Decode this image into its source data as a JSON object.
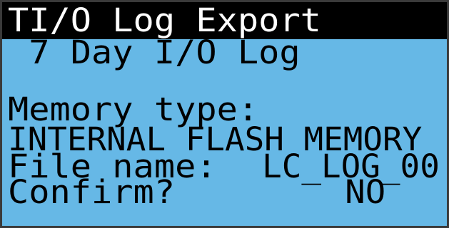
{
  "title": "TI/O Log Export",
  "subtitle": " 7 Day I/O Log",
  "memory": {
    "label": "Memory type:",
    "value": "INTERNAL FLASH MEMORY"
  },
  "file": {
    "label": "File name:",
    "value": "LC_LOG_00"
  },
  "confirm": {
    "label": "Confirm?",
    "value": "NO"
  },
  "colors": {
    "screen_background": "#66b8e6",
    "title_background": "#000000",
    "title_text": "#ffffff",
    "text": "#000000"
  }
}
